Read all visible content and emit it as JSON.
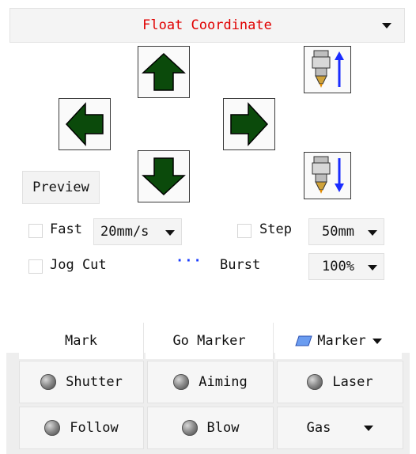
{
  "coordinate_select": {
    "value": "Float Coordinate"
  },
  "jog": {
    "up": "arrow-up",
    "down": "arrow-down",
    "left": "arrow-left",
    "right": "arrow-right",
    "z_up": "laser-head-z-up",
    "z_down": "laser-head-z-down"
  },
  "preview_label": "Preview",
  "options": {
    "fast_label": "Fast",
    "fast_speed": "20mm/s",
    "step_label": "Step",
    "step_value": "50mm",
    "jog_cut_label": "Jog Cut",
    "burst_dots": "···",
    "burst_label": "Burst",
    "burst_value": "100%"
  },
  "tabs": {
    "mark": "Mark",
    "go_marker": "Go Marker",
    "marker": "Marker"
  },
  "controls": {
    "shutter": "Shutter",
    "aiming": "Aiming",
    "laser": "Laser",
    "follow": "Follow",
    "blow": "Blow",
    "gas": "Gas"
  },
  "colors": {
    "arrow_green": "#0b4a0b",
    "title_red": "#e00000",
    "z_arrow_blue": "#1a2cff",
    "burst_blue": "#1a3cff"
  }
}
